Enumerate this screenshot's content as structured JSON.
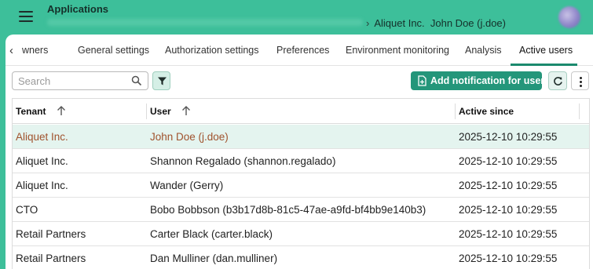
{
  "header": {
    "app_title": "Applications",
    "breadcrumb_chevron": "›",
    "breadcrumb": "Aliquet Inc.  John Doe (j.doe)"
  },
  "tabs": {
    "back_label": "‹",
    "items": [
      {
        "label": "wners"
      },
      {
        "label": "General settings"
      },
      {
        "label": "Authorization settings"
      },
      {
        "label": "Preferences"
      },
      {
        "label": "Environment monitoring"
      },
      {
        "label": "Analysis"
      },
      {
        "label": "Active users"
      }
    ],
    "active_index": 6
  },
  "toolbar": {
    "search_placeholder": "Search",
    "search_value": "",
    "add_notification_label": "Add notification for user"
  },
  "table": {
    "columns": [
      "Tenant",
      "User",
      "Active since"
    ],
    "rows": [
      {
        "tenant": "Aliquet Inc.",
        "user": "John Doe (j.doe)",
        "since": "2025-12-10 10:29:55",
        "selected": true
      },
      {
        "tenant": "Aliquet Inc.",
        "user": "Shannon Regalado (shannon.regalado)",
        "since": "2025-12-10 10:29:55"
      },
      {
        "tenant": "Aliquet Inc.",
        "user": "Wander (Gerry)",
        "since": "2025-12-10 10:29:55"
      },
      {
        "tenant": "CTO",
        "user": "Bobo Bobbson (b3b17d8b-81c5-47ae-a9fd-bf4bb9e140b3)",
        "since": "2025-12-10 10:29:55"
      },
      {
        "tenant": "Retail Partners",
        "user": "Carter Black (carter.black)",
        "since": "2025-12-10 10:29:55"
      },
      {
        "tenant": "Retail Partners",
        "user": "Dan Mulliner (dan.mulliner)",
        "since": "2025-12-10 10:29:55"
      }
    ]
  },
  "colors": {
    "brand": "#3dbf9a",
    "primary_button": "#24967a",
    "selected_row": "#e4f4ef",
    "selected_text": "#a0522d"
  },
  "icons": [
    "hamburger-menu-icon",
    "chevron-right-icon",
    "chevron-left-icon",
    "search-icon",
    "filter-icon",
    "add-notification-icon",
    "refresh-icon",
    "more-vertical-icon",
    "sort-ascending-icon"
  ]
}
